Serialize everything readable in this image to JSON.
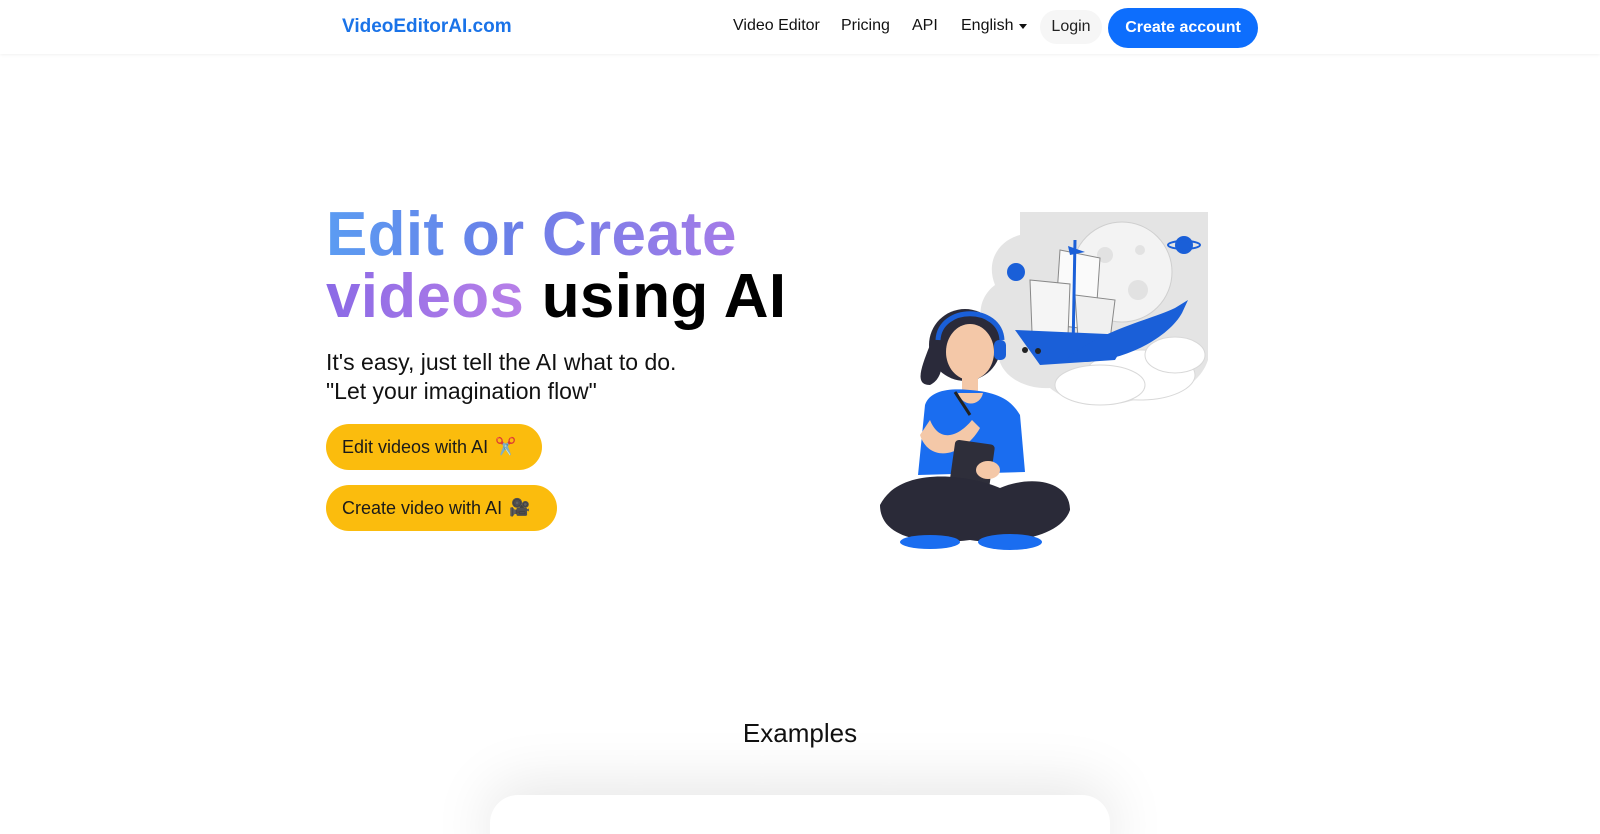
{
  "brand": {
    "name": "VideoEditorAI.com",
    "color": "#1a73e8"
  },
  "nav": {
    "links": [
      "Video Editor",
      "Pricing",
      "API"
    ],
    "language": "English",
    "login": "Login",
    "create_account": "Create account"
  },
  "hero": {
    "title_part1": "Edit or Create",
    "title_part2": "videos",
    "title_part3": "using AI",
    "subtitle_line1": "It's easy, just tell the AI what to do.",
    "subtitle_line2": "\"Let your imagination flow\"",
    "edit_button": "Edit videos with AI",
    "edit_button_emoji": "✂️",
    "create_button": "Create video with AI",
    "create_button_emoji": "🎥",
    "illustration_icon": "girl-dreaming-illustration"
  },
  "examples": {
    "title": "Examples"
  },
  "colors": {
    "accent": "#0d6efd",
    "cta_yellow": "#fbbc0d",
    "gradient_start": "#5b9cf2",
    "gradient_end": "#b880e8"
  }
}
